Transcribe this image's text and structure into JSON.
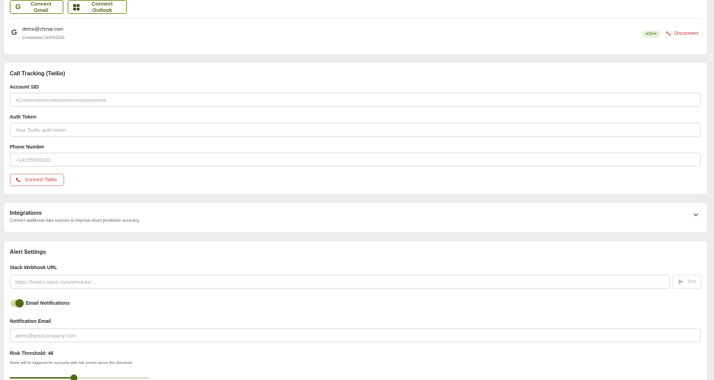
{
  "email_connect": {
    "gmail_button": "Connect Gmail",
    "gmail_icon": "google-g-icon",
    "outlook_button": "Connect Outlook",
    "outlook_icon": "microsoft-windows-icon",
    "account": {
      "icon": "google-g-icon",
      "email": "demo@chrnai.com",
      "connected": "Connected 15/03/2026",
      "status": "active",
      "disconnect_label": "Disconnect",
      "disconnect_icon": "unlink-icon"
    },
    "colors": {
      "accent": "#5a6b1a",
      "danger": "#c43d3d",
      "active_bg": "#e7f1dc"
    }
  },
  "call_tracking": {
    "title": "Call Tracking (Twilio)",
    "account_sid": {
      "label": "Account SID",
      "placeholder": "ACxxxxxxxxxxxxxxxxxxxxxxxxxxxxxxxx",
      "value": ""
    },
    "auth_token": {
      "label": "Auth Token",
      "placeholder": "Your Twilio auth token",
      "value": ""
    },
    "phone_number": {
      "label": "Phone Number",
      "placeholder": "+14155550100",
      "value": ""
    },
    "connect_button": "Connect Twilio",
    "connect_icon": "phone-icon"
  },
  "integrations": {
    "title": "Integrations",
    "description": "Connect additional data sources to improve churn prediction accuracy.",
    "expand_icon": "chevron-down-icon"
  },
  "alert_settings": {
    "title": "Alert Settings",
    "slack": {
      "label": "Slack Webhook URL",
      "placeholder": "https://hooks.slack.com/services/...",
      "value": ""
    },
    "test_button": "Test",
    "test_icon": "send-icon",
    "email_notifications": {
      "label": "Email Notifications",
      "enabled": true
    },
    "notification_email": {
      "label": "Notification Email",
      "placeholder": "alerts@yourcompany.com",
      "value": ""
    },
    "risk_threshold": {
      "label": "Risk Threshold: 46",
      "value": 46,
      "min": 0,
      "max": 100,
      "description": "Alerts will be triggered for accounts with risk scores above this threshold"
    }
  }
}
